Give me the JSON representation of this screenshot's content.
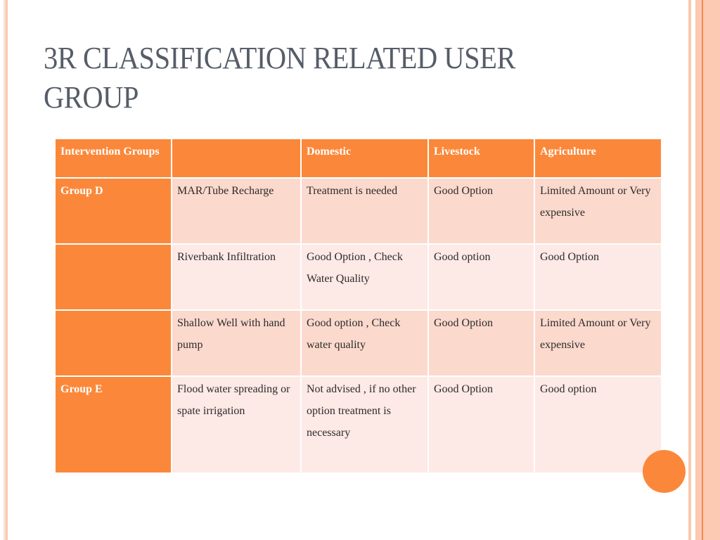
{
  "slide": {
    "title": "3R CLASSIFICATION RELATED USER GROUP",
    "colors": {
      "accent": "#fb883a",
      "title_text": "#565d68",
      "row_dark": "#fcd9cd",
      "row_light": "#fde9e5"
    }
  },
  "table": {
    "headers": [
      "Intervention Groups",
      "",
      "Domestic",
      "Livestock",
      "Agriculture"
    ],
    "rows": [
      {
        "group": "Group D",
        "intervention": "MAR/Tube Recharge",
        "domestic": "Treatment is needed",
        "livestock": "Good Option",
        "agriculture": "Limited Amount or Very expensive"
      },
      {
        "group": "",
        "intervention": "Riverbank Infiltration",
        "domestic": "Good Option , Check Water Quality",
        "livestock": "Good option",
        "agriculture": "Good Option"
      },
      {
        "group": "",
        "intervention": "Shallow Well with hand pump",
        "domestic": "Good option , Check water quality",
        "livestock": "Good Option",
        "agriculture": "Limited Amount or Very expensive"
      },
      {
        "group": "Group E",
        "intervention": "Flood water spreading or spate irrigation",
        "domestic": "Not advised , if no other option treatment is necessary",
        "livestock": "Good Option",
        "agriculture": "Good option"
      }
    ]
  }
}
